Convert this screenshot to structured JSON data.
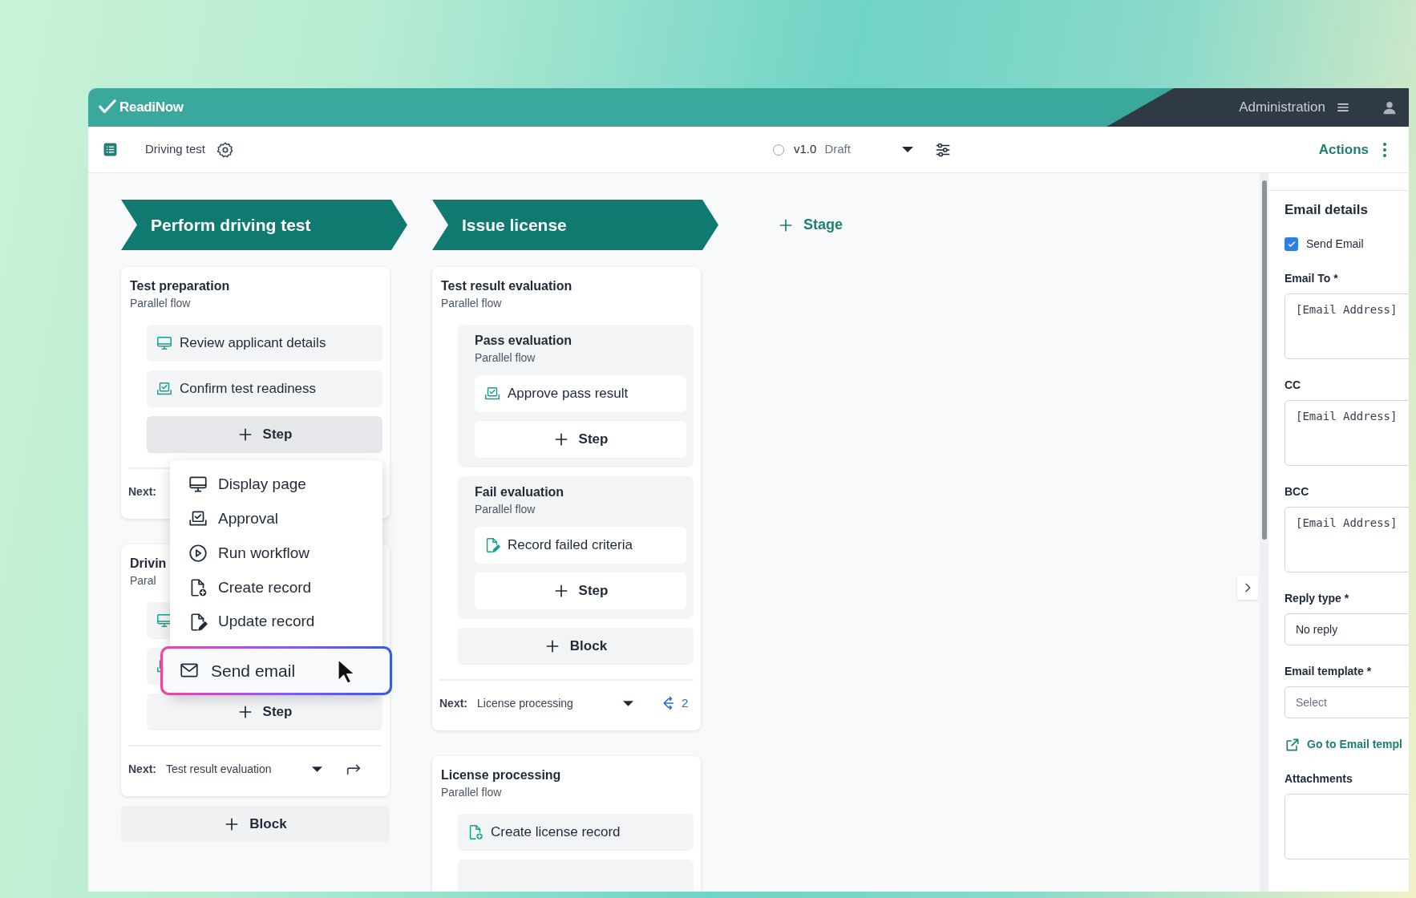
{
  "header": {
    "brand": "ReadiNow",
    "admin_label": "Administration"
  },
  "toolbar": {
    "title": "Driving test",
    "version": "v1.0",
    "status": "Draft",
    "actions": "Actions"
  },
  "stages": [
    {
      "label": "Perform driving test",
      "cards": [
        {
          "title": "Test preparation",
          "subtitle": "Parallel flow",
          "items": [
            {
              "kind": "display",
              "label": "Review applicant details"
            },
            {
              "kind": "approval",
              "label": "Confirm test readiness"
            },
            {
              "kind": "add",
              "label": "Step",
              "pressed": true
            }
          ],
          "next": {
            "label": "Next:"
          }
        },
        {
          "title": "Drivin",
          "subtitle": "Paral",
          "items": [
            {
              "kind": "display"
            },
            {
              "kind": "approval"
            },
            {
              "kind": "add",
              "label": "Step",
              "pressed": false
            }
          ],
          "next": {
            "label": "Next:",
            "value": "Test result evaluation"
          }
        }
      ],
      "add_block": "Block"
    },
    {
      "label": "Issue license",
      "cards": [
        {
          "title": "Test result evaluation",
          "subtitle": "Parallel flow",
          "items": [
            {
              "kind": "block",
              "title": "Pass evaluation",
              "subtitle": "Parallel flow",
              "items": [
                {
                  "kind": "approval",
                  "label": "Approve pass result"
                },
                {
                  "kind": "add",
                  "label": "Step",
                  "pressed": false
                }
              ]
            },
            {
              "kind": "block",
              "title": "Fail evaluation",
              "subtitle": "Parallel flow",
              "items": [
                {
                  "kind": "update_record",
                  "label": "Record failed criteria"
                },
                {
                  "kind": "add",
                  "label": "Step",
                  "pressed": false
                }
              ]
            },
            {
              "kind": "add",
              "label": "Block",
              "pressed": false
            }
          ],
          "next": {
            "label": "Next:",
            "value": "License processing",
            "branches": "2"
          }
        },
        {
          "title": "License processing",
          "subtitle": "Parallel flow",
          "items": [
            {
              "kind": "create_record",
              "label": "Create license record"
            },
            {
              "kind": "partial"
            }
          ]
        }
      ]
    }
  ],
  "add_stage": "Stage",
  "menu": {
    "items": [
      {
        "kind": "display",
        "label": "Display page",
        "selected": false
      },
      {
        "kind": "approval",
        "label": "Approval",
        "selected": false
      },
      {
        "kind": "run_workflow",
        "label": "Run workflow",
        "selected": false
      },
      {
        "kind": "create_record",
        "label": "Create record",
        "selected": false
      },
      {
        "kind": "update_record",
        "label": "Update record",
        "selected": false
      },
      {
        "kind": "send_email",
        "label": "Send email",
        "selected": true
      }
    ]
  },
  "panel": {
    "title": "Email details",
    "send_email": {
      "label": "Send Email",
      "checked": true
    },
    "fields": [
      {
        "kind": "textarea",
        "label": "Email To *",
        "placeholder": "[Email Address]"
      },
      {
        "kind": "textarea",
        "label": "CC",
        "placeholder": "[Email Address]"
      },
      {
        "kind": "textarea",
        "label": "BCC",
        "placeholder": "[Email Address]"
      },
      {
        "kind": "select",
        "label": "Reply type *",
        "value": "No reply"
      },
      {
        "kind": "select",
        "label": "Email template *",
        "placeholder": "Select"
      },
      {
        "kind": "link",
        "label": "Go to Email templ"
      },
      {
        "kind": "textarea",
        "label": "Attachments"
      }
    ]
  }
}
